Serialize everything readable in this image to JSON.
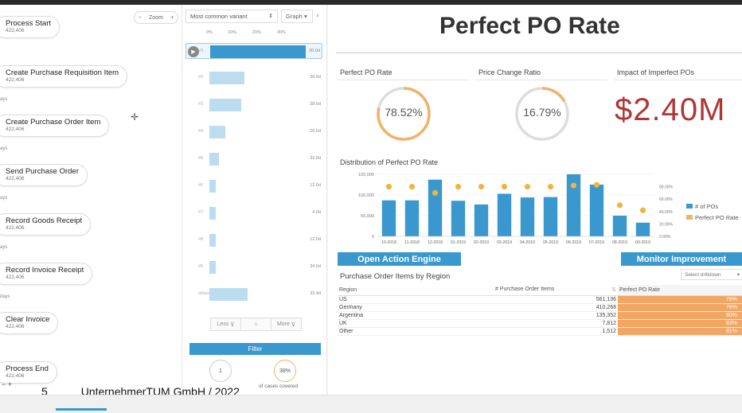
{
  "process_flow": {
    "zoom_label": "Zoom",
    "zoom_minus": "−",
    "zoom_plus": "+",
    "nodes": [
      {
        "title": "Process Start",
        "count": "422,406"
      },
      {
        "title": "Create Purchase Requisition Item",
        "count": "422,406"
      },
      {
        "title": "Create Purchase Order Item",
        "count": "422,406"
      },
      {
        "title": "Send Purchase Order",
        "count": "422,406"
      },
      {
        "title": "Record Goods Receipt",
        "count": "422,406"
      },
      {
        "title": "Record Invoice Receipt",
        "count": "422,406"
      },
      {
        "title": "Clear Invoice",
        "count": "422,406"
      },
      {
        "title": "Process End",
        "count": "422,406"
      }
    ],
    "edge_labels": [
      "ays",
      "ays",
      "ays",
      "ays",
      "ays",
      "days"
    ],
    "footer_controls": "−  +"
  },
  "variants": {
    "selector_value": "Most common variant",
    "graph_button": "Graph",
    "axis_ticks": [
      "0%",
      "10%",
      "20%",
      "30%"
    ],
    "rows": [
      {
        "label": "#1",
        "share": 0.3,
        "duration": "30.0d"
      },
      {
        "label": "#2",
        "share": 0.11,
        "duration": "36.0d"
      },
      {
        "label": "#3",
        "share": 0.1,
        "duration": "28.0d"
      },
      {
        "label": "#4",
        "share": 0.05,
        "duration": "25.0d"
      },
      {
        "label": "#5",
        "share": 0.03,
        "duration": "32.0d"
      },
      {
        "label": "#6",
        "share": 0.02,
        "duration": "12.0d"
      },
      {
        "label": "#7",
        "share": 0.02,
        "duration": "4.0d"
      },
      {
        "label": "#8",
        "share": 0.02,
        "duration": "12.0d"
      },
      {
        "label": "#9",
        "share": 0.02,
        "duration": "34.0d"
      },
      {
        "label": "others",
        "share": 0.12,
        "duration": "33.4d"
      }
    ],
    "less_label": "Less",
    "more_label": "More",
    "filter_label": "Filter",
    "variants_count": "1",
    "cases_percent": "38%",
    "cases_text": "of cases covered"
  },
  "slide_footer": {
    "page_number": "5",
    "text": "UnternehmerTUM GmbH / 2022"
  },
  "dashboard": {
    "title": "Perfect PO Rate",
    "kpis": {
      "perfect_po_rate": {
        "label": "Perfect PO Rate",
        "value": "78.52%",
        "fraction": 0.7852
      },
      "price_change_ratio": {
        "label": "Price Change Ratio",
        "value": "16.79%",
        "fraction": 0.1679
      },
      "impact": {
        "label": "Impact of Imperfect POs",
        "value": "$2.40M"
      }
    },
    "distribution_title": "Distribution of Perfect PO Rate",
    "open_action_engine": "Open Action Engine",
    "monitor_improvement": "Monitor Improvement",
    "po_table": {
      "title": "Purchase Order Items by Region",
      "drilldown": "Select drilldown",
      "columns": [
        "Region",
        "# Purchase Order Items",
        "Perfect PO Rate"
      ],
      "rows": [
        {
          "region": "US",
          "items": "561,136",
          "rate": "78%"
        },
        {
          "region": "Germany",
          "items": "410,268",
          "rate": "78%"
        },
        {
          "region": "Argentina",
          "items": "135,352",
          "rate": "80%"
        },
        {
          "region": "UK",
          "items": "7,812",
          "rate": "83%"
        },
        {
          "region": "Other",
          "items": "1,512",
          "rate": "81%"
        }
      ]
    }
  },
  "chart_data": {
    "type": "bar",
    "categories": [
      "10-2018",
      "11-2018",
      "12-2018",
      "01-2019",
      "02-2019",
      "03-2019",
      "04-2019",
      "05-2019",
      "06-2019",
      "07-2019",
      "08-2019",
      "09-2019"
    ],
    "series": [
      {
        "name": "# of POs",
        "type": "bar",
        "axis": "left",
        "values": [
          87000,
          87000,
          137000,
          86000,
          77000,
          103000,
          94000,
          95000,
          150000,
          125000,
          50000,
          33000
        ]
      },
      {
        "name": "Perfect PO Rate",
        "type": "scatter",
        "axis": "right",
        "values": [
          80,
          80,
          70,
          80,
          80,
          80,
          80,
          80,
          82,
          83,
          50,
          42
        ]
      }
    ],
    "ylim_left": [
      0,
      150000
    ],
    "left_ticks": [
      "0",
      "50,000",
      "100,000",
      "150,000"
    ],
    "ylim_right": [
      0,
      100
    ],
    "right_ticks": [
      "0.00%",
      "20.00%",
      "40.00%",
      "60.00%",
      "80.00%"
    ],
    "legend_position": "right",
    "colors": {
      "bars": "#3a98cf",
      "points": "#f0b441"
    }
  }
}
